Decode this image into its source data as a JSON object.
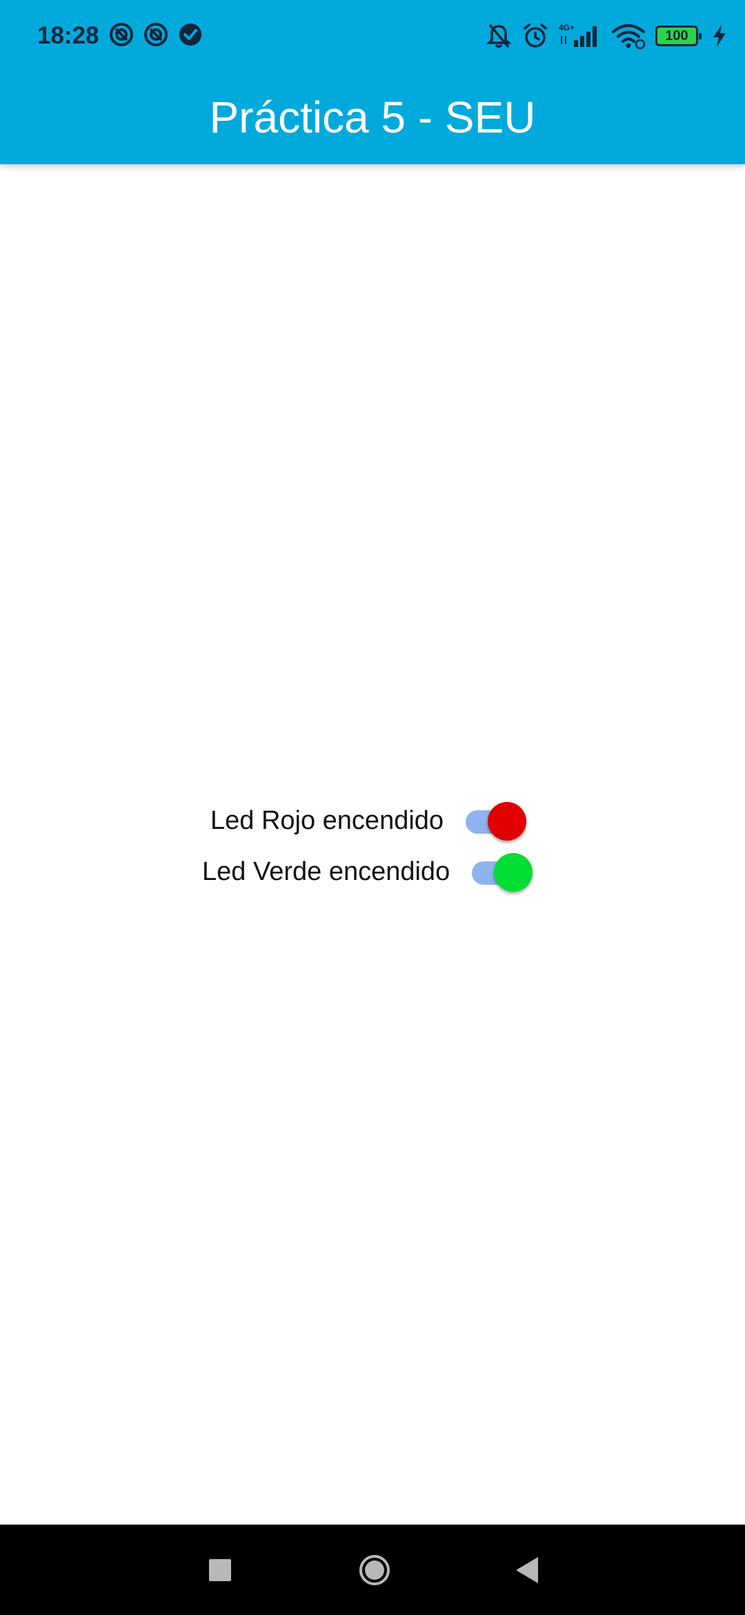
{
  "status_bar": {
    "time": "18:28",
    "left_icons": [
      "notification-app-icon",
      "notification-app-icon",
      "check-circle-icon"
    ],
    "right_icons": [
      "mute-icon",
      "alarm-icon",
      "signal-4g-icon",
      "wifi-icon",
      "battery-icon",
      "charging-icon"
    ],
    "network": "4G+",
    "battery_level": "100"
  },
  "app_bar": {
    "title": "Práctica 5 - SEU",
    "color": "#00a9dc"
  },
  "switches": [
    {
      "label": "Led Rojo encendido",
      "checked": true,
      "thumb_color": "#e00000"
    },
    {
      "label": "Led Verde encendido",
      "checked": true,
      "thumb_color": "#00dd33"
    }
  ],
  "nav_bar": {
    "buttons": [
      "recents-icon",
      "home-icon",
      "back-icon"
    ]
  }
}
